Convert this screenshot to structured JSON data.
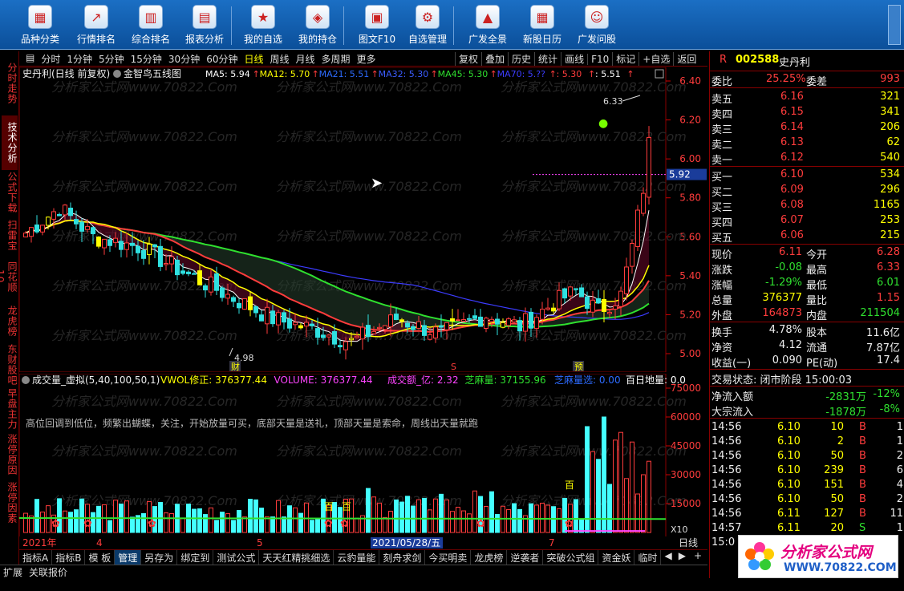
{
  "toolbar": {
    "buttons": [
      "品种分类",
      "行情排名",
      "综合排名",
      "报表分析",
      "我的自选",
      "我的持仓",
      "图文F10",
      "自选管理",
      "广发全景",
      "新股日历",
      "广发问股"
    ]
  },
  "left_tabs": [
    "分时走势",
    "技术分析",
    "公式下载",
    "扫雷宝",
    "同花顺10",
    "龙虎榜",
    "东财股吧",
    "早盘主力",
    "涨停原因",
    "涨停因素"
  ],
  "period_bar": {
    "left": [
      "分时",
      "1分钟",
      "5分钟",
      "15分钟",
      "30分钟",
      "60分钟",
      "日线",
      "周线",
      "月线",
      "多周期",
      "更多"
    ],
    "active": "日线",
    "right": [
      "复权",
      "叠加",
      "历史",
      "统计",
      "画线",
      "F10",
      "标记",
      "+自选",
      "返回"
    ]
  },
  "main_chart": {
    "title": "史丹利(日线 前复权)",
    "indicator": "金智鸟五线图",
    "ma": [
      {
        "label": "MA5: 5.94",
        "color": "#ffffff"
      },
      {
        "label": "MA12: 5.70",
        "color": "#ffff00"
      },
      {
        "label": "MA21: 5.51",
        "color": "#2d6bff"
      },
      {
        "label": "MA32: 5.30",
        "color": "#3b5cff"
      },
      {
        "label": "MA45: 5.30",
        "color": "#2fe02f"
      },
      {
        "label": "MA70: 5.??",
        "color": "#3c3cff"
      },
      {
        "label": ": 5.30",
        "color": "#ff3c3c"
      },
      {
        "label": ": 5.51",
        "color": "#ffffff"
      }
    ],
    "price_axis": [
      "6.40",
      "6.20",
      "6.00",
      "5.80",
      "5.60",
      "5.40",
      "5.20",
      "5.00"
    ],
    "current_price": "5.92",
    "high_label": "6.33",
    "low_label": "4.98",
    "marks": [
      "财",
      "S",
      "预"
    ],
    "watermark": "分析家公式网www.70822.Com"
  },
  "volume_chart": {
    "title": "成交量_虚拟(5,40,100,50,1)",
    "items": [
      {
        "label": "VWOL修正: 376377.44",
        "color": "#ffff00"
      },
      {
        "label": "VOLUME: 376377.44",
        "color": "#ff44ff"
      },
      {
        "label": "成交额_亿: 2.32",
        "color": "#ff44ff"
      },
      {
        "label": "芝麻量: 37155.96",
        "color": "#2fe02f"
      },
      {
        "label": "芝麻量选: 0.00",
        "color": "#2d6bff"
      },
      {
        "label": "百日地量: 0.0",
        "color": "#ffffff"
      }
    ],
    "note": "高位回调到低位，频繁出蝴蝶，关注，开始放量可买，底部天量是送礼，顶部天量是索命，周线出天量就跑",
    "vol_axis": [
      "75000",
      "60000",
      "45000",
      "30000",
      "15000"
    ],
    "x10": "X10",
    "bai_labels": [
      "百",
      "百",
      "百"
    ]
  },
  "x_axis": [
    "2021年",
    "4",
    "5",
    "2021/05/28/五",
    "7"
  ],
  "axis_mode": "日线",
  "bottom_tabs": [
    "指标A",
    "指标B",
    "模 板",
    "管理",
    "另存为",
    "绑定到",
    "测试公式",
    "天天红精挑细选",
    "云豹量能",
    "刻舟求剑",
    "今买明卖",
    "龙虎榜",
    "逆袭者",
    "突破公式组",
    "资金妖",
    "临时"
  ],
  "bottom_active": "管理",
  "status": [
    "扩展",
    "关联报价"
  ],
  "quote": {
    "flag": "R",
    "code": "002588",
    "name": "史丹利",
    "weibi": {
      "l": "委比",
      "v": "25.25%",
      "l2": "委差",
      "v2": "993"
    },
    "asks": [
      [
        "卖五",
        "6.16",
        "321"
      ],
      [
        "卖四",
        "6.15",
        "341"
      ],
      [
        "卖三",
        "6.14",
        "206"
      ],
      [
        "卖二",
        "6.13",
        "62"
      ],
      [
        "卖一",
        "6.12",
        "540"
      ]
    ],
    "bids": [
      [
        "买一",
        "6.10",
        "534"
      ],
      [
        "买二",
        "6.09",
        "296"
      ],
      [
        "买三",
        "6.08",
        "1165"
      ],
      [
        "买四",
        "6.07",
        "253"
      ],
      [
        "买五",
        "6.06",
        "215"
      ]
    ],
    "stats": [
      [
        "现价",
        "6.11",
        "今开",
        "6.28"
      ],
      [
        "涨跌",
        "-0.08",
        "最高",
        "6.33"
      ],
      [
        "涨幅",
        "-1.29%",
        "最低",
        "6.01"
      ],
      [
        "总量",
        "376377",
        "量比",
        "1.15"
      ],
      [
        "外盘",
        "164873",
        "内盘",
        "211504"
      ]
    ],
    "stats2": [
      [
        "换手",
        "4.78%",
        "股本",
        "11.6亿"
      ],
      [
        "净资",
        "4.12",
        "流通",
        "7.87亿"
      ],
      [
        "收益(一)",
        "0.090",
        "PE(动)",
        "17.4"
      ]
    ],
    "trade_state": "交易状态: 闭市阶段 15:00:03",
    "flows": [
      [
        "净流入额",
        "-2831万",
        "-12%"
      ],
      [
        "大宗流入",
        "-1878万",
        "-8%"
      ]
    ],
    "ticks": [
      [
        "14:56",
        "6.10",
        "10",
        "B",
        "1"
      ],
      [
        "14:56",
        "6.10",
        "2",
        "B",
        "1"
      ],
      [
        "14:56",
        "6.10",
        "50",
        "B",
        "2"
      ],
      [
        "14:56",
        "6.10",
        "239",
        "B",
        "6"
      ],
      [
        "14:56",
        "6.10",
        "151",
        "B",
        "4"
      ],
      [
        "14:56",
        "6.10",
        "50",
        "B",
        "2"
      ],
      [
        "14:56",
        "6.11",
        "127",
        "B",
        "11"
      ],
      [
        "14:57",
        "6.11",
        "20",
        "S",
        "1"
      ]
    ],
    "last_time": "15:0"
  },
  "logo": {
    "title": "分析家公式网",
    "url": "WWW.70822.COM"
  },
  "colors": {
    "up": "#ff3c3c",
    "down": "#2fe0e0",
    "bg": "#000000",
    "border": "#8a0000"
  }
}
